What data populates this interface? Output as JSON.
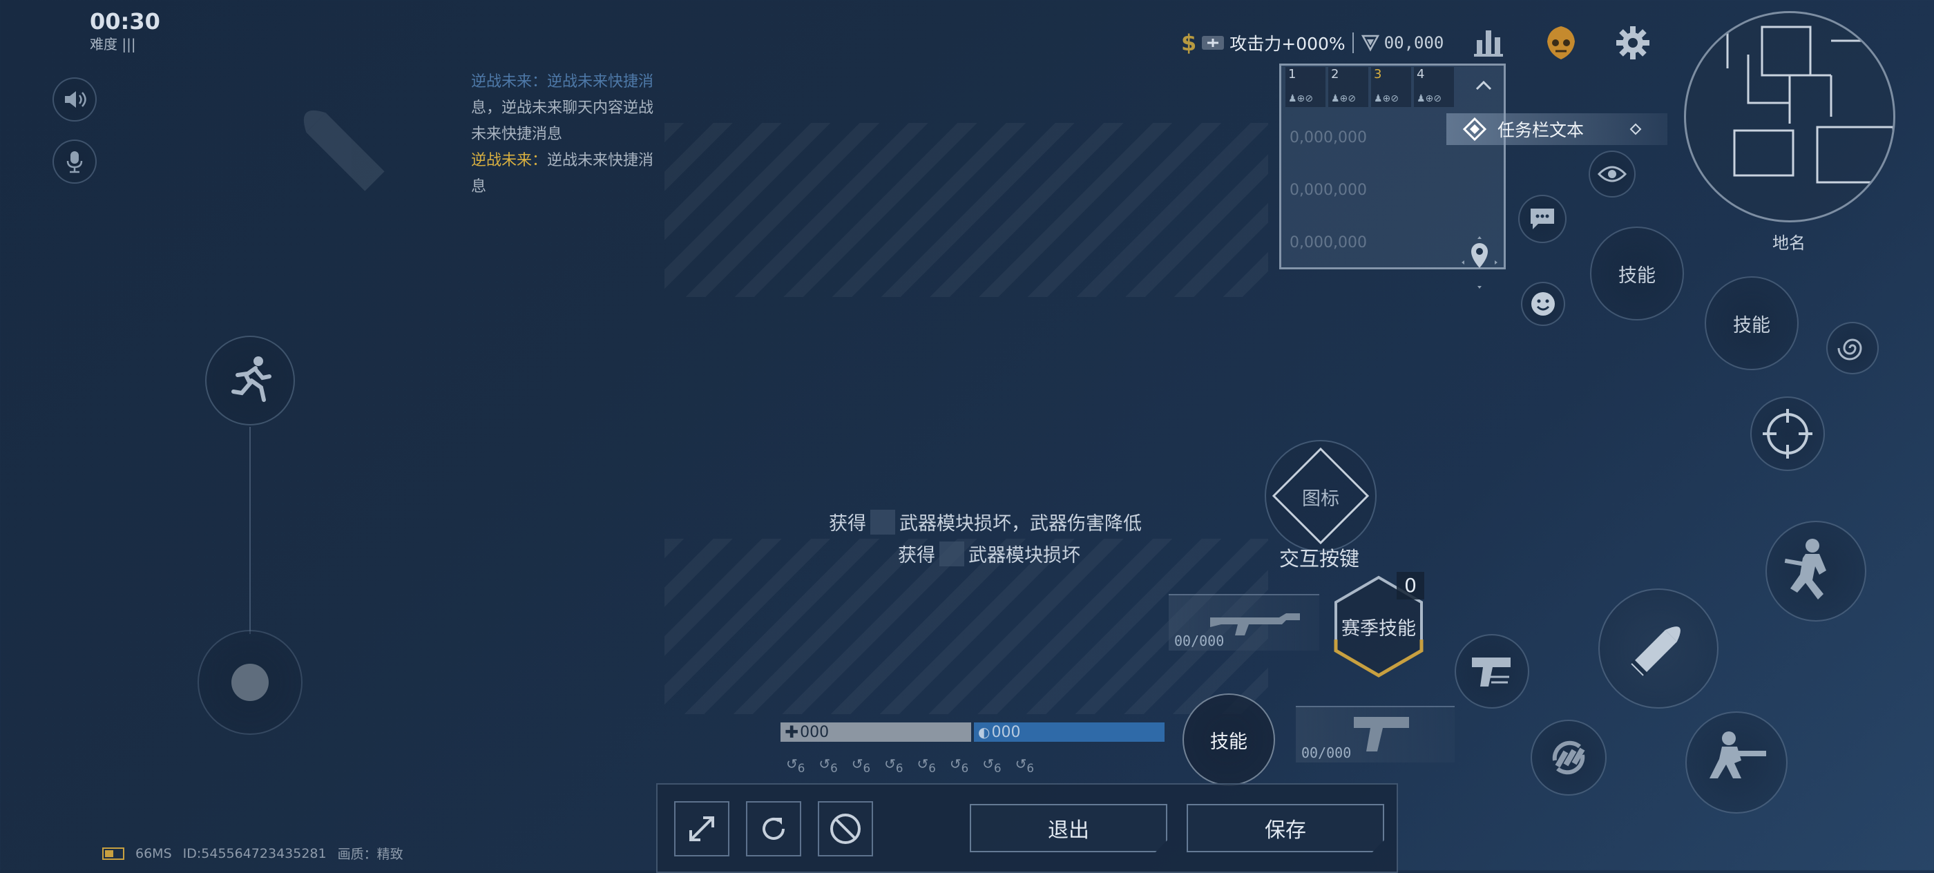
{
  "timer": {
    "time": "00:30",
    "difficulty": "难度 |||"
  },
  "chat": {
    "line1": "逆战未来：逆战未来快捷消",
    "line2": "息，逆战未来聊天内容逆战",
    "line3": "未来快捷消息",
    "line4_prefix": "逆战未来：",
    "line4_text": "逆战未来快捷消",
    "line5": "息"
  },
  "topbar": {
    "currency": "$",
    "attack": "攻击力+000%",
    "resource": "00,000"
  },
  "team": {
    "slots": [
      "1",
      "2",
      "3",
      "4"
    ],
    "rows": [
      "0,000,000",
      "0,000,000",
      "0,000,000"
    ]
  },
  "task": {
    "label": "任务栏文本"
  },
  "minimap": {
    "place_name": "地名"
  },
  "skills": {
    "skill1": "技能",
    "skill2": "技能",
    "skill3": "技能",
    "season_skill": "赛季技能",
    "season_count": "0"
  },
  "interact": {
    "icon_label": "图标",
    "label": "交互按键"
  },
  "center_msg": {
    "line1_prefix": "获得",
    "line1_text": "武器模块损坏，武器伤害降低",
    "line2_prefix": "获得",
    "line2_text": "武器模块损坏"
  },
  "weapons": {
    "primary_ammo": "00/000",
    "secondary_ammo": "00/000"
  },
  "status": {
    "hp": "000",
    "armor": "000",
    "buff_count": "6"
  },
  "editor": {
    "exit_label": "退出",
    "save_label": "保存"
  },
  "bottom_info": {
    "ping": "66MS",
    "id": "ID:545564723435281",
    "quality": "画质：精致"
  },
  "colors": {
    "accent_gold": "#d9b040",
    "hp_bar": "#8c96a2",
    "armor_bar": "#2f6aa8"
  }
}
